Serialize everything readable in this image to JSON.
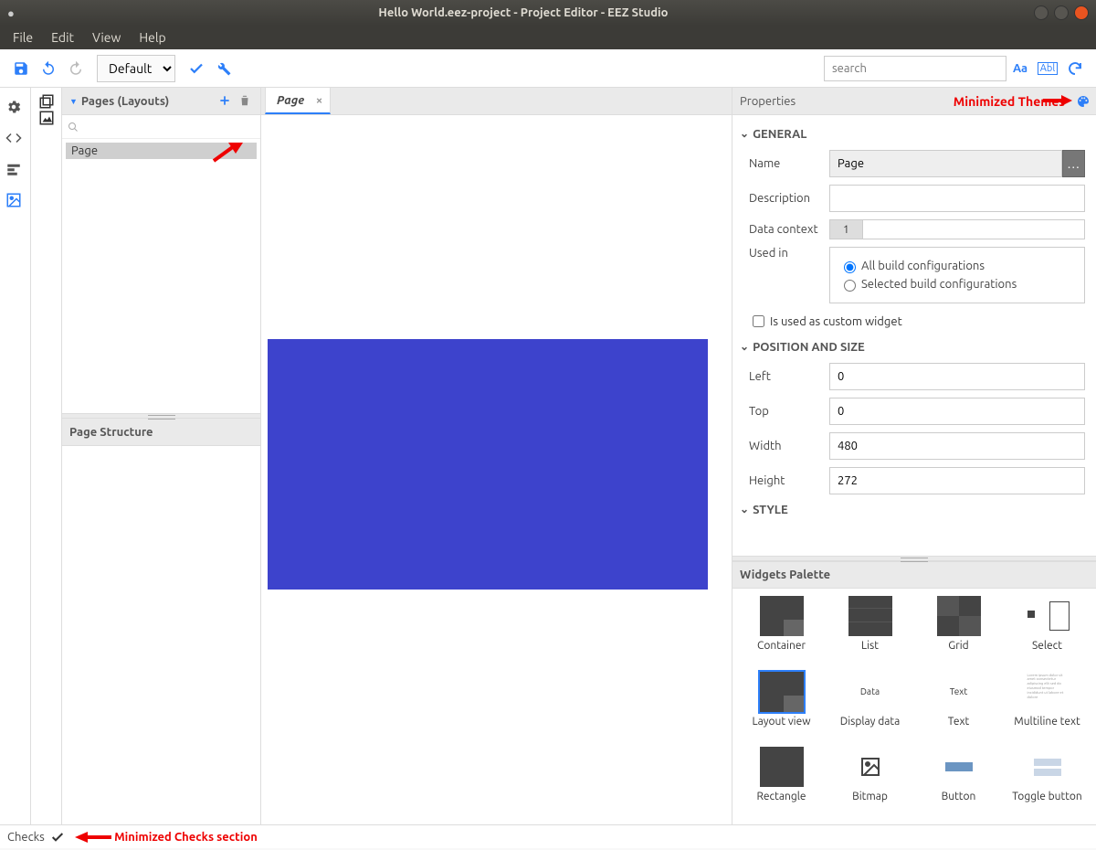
{
  "window": {
    "title": "Hello World.eez-project - Project Editor - EEZ Studio",
    "dirty": "●"
  },
  "menubar": [
    "File",
    "Edit",
    "View",
    "Help"
  ],
  "toolbar": {
    "config_selected": "Default",
    "search_placeholder": "search"
  },
  "left": {
    "pages_panel_title": "Pages (Layouts)",
    "pages_search_placeholder": "",
    "pages": [
      "Page"
    ],
    "structure_panel_title": "Page Structure"
  },
  "center": {
    "tab_label": "Page",
    "page_color": "#3d43cc"
  },
  "props": {
    "panel_title": "Properties",
    "annotation_themes": "Minimized Themes",
    "sections": {
      "general": "GENERAL",
      "pos": "POSITION AND SIZE",
      "style": "STYLE"
    },
    "name_label": "Name",
    "name_value": "Page",
    "desc_label": "Description",
    "desc_value": "",
    "datactx_label": "Data context",
    "datactx_tab": "1",
    "usedin_label": "Used in",
    "usedin_all": "All build configurations",
    "usedin_sel": "Selected build configurations",
    "custom_widget_label": "Is used as custom widget",
    "left_label": "Left",
    "left_value": "0",
    "top_label": "Top",
    "top_value": "0",
    "width_label": "Width",
    "width_value": "480",
    "height_label": "Height",
    "height_value": "272"
  },
  "palette": {
    "title": "Widgets Palette",
    "widgets": [
      "Container",
      "List",
      "Grid",
      "Select",
      "Layout view",
      "Display data",
      "Text",
      "Multiline text",
      "Rectangle",
      "Bitmap",
      "Button",
      "Toggle button"
    ]
  },
  "status": {
    "checks_label": "Checks",
    "annotation_checks": "Minimized Checks section"
  }
}
